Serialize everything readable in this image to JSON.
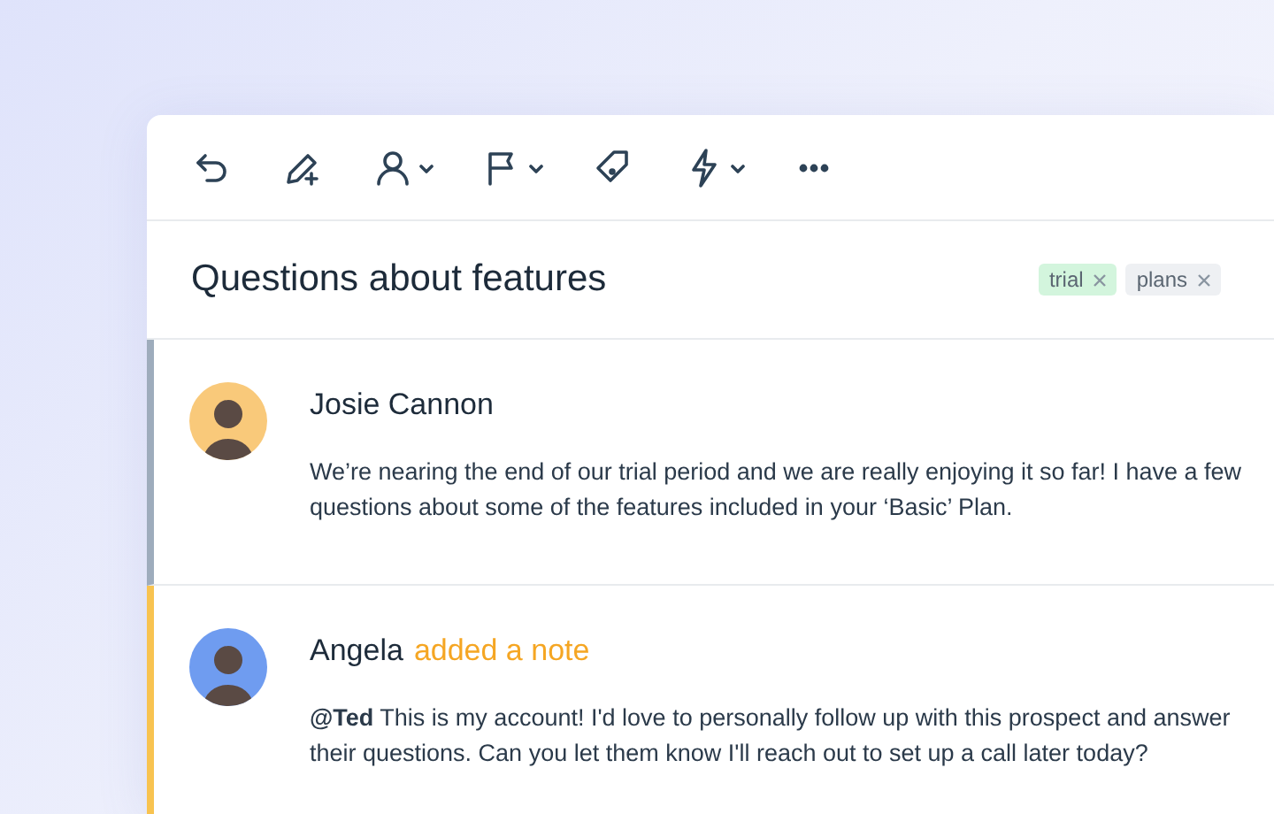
{
  "conversation": {
    "title": "Questions about features",
    "tags": [
      {
        "label": "trial",
        "color": "#d3f5dd"
      },
      {
        "label": "plans",
        "color": "#eef0f3"
      }
    ],
    "messages": [
      {
        "kind": "message",
        "author": "Josie Cannon",
        "color": "#f9c97a",
        "body": "We’re nearing the end of our trial period and we are really enjoying it so far! I have a few questions about some of the features included in your ‘Basic’ Plan."
      },
      {
        "kind": "note",
        "author": "Angela",
        "action": "added a note",
        "color": "#6f9cf0",
        "body": "**@Ted** This is my account! I'd love to personally follow up with this prospect and answer their questions. Can you let them know I'll reach out to set up a call later today?"
      }
    ]
  }
}
